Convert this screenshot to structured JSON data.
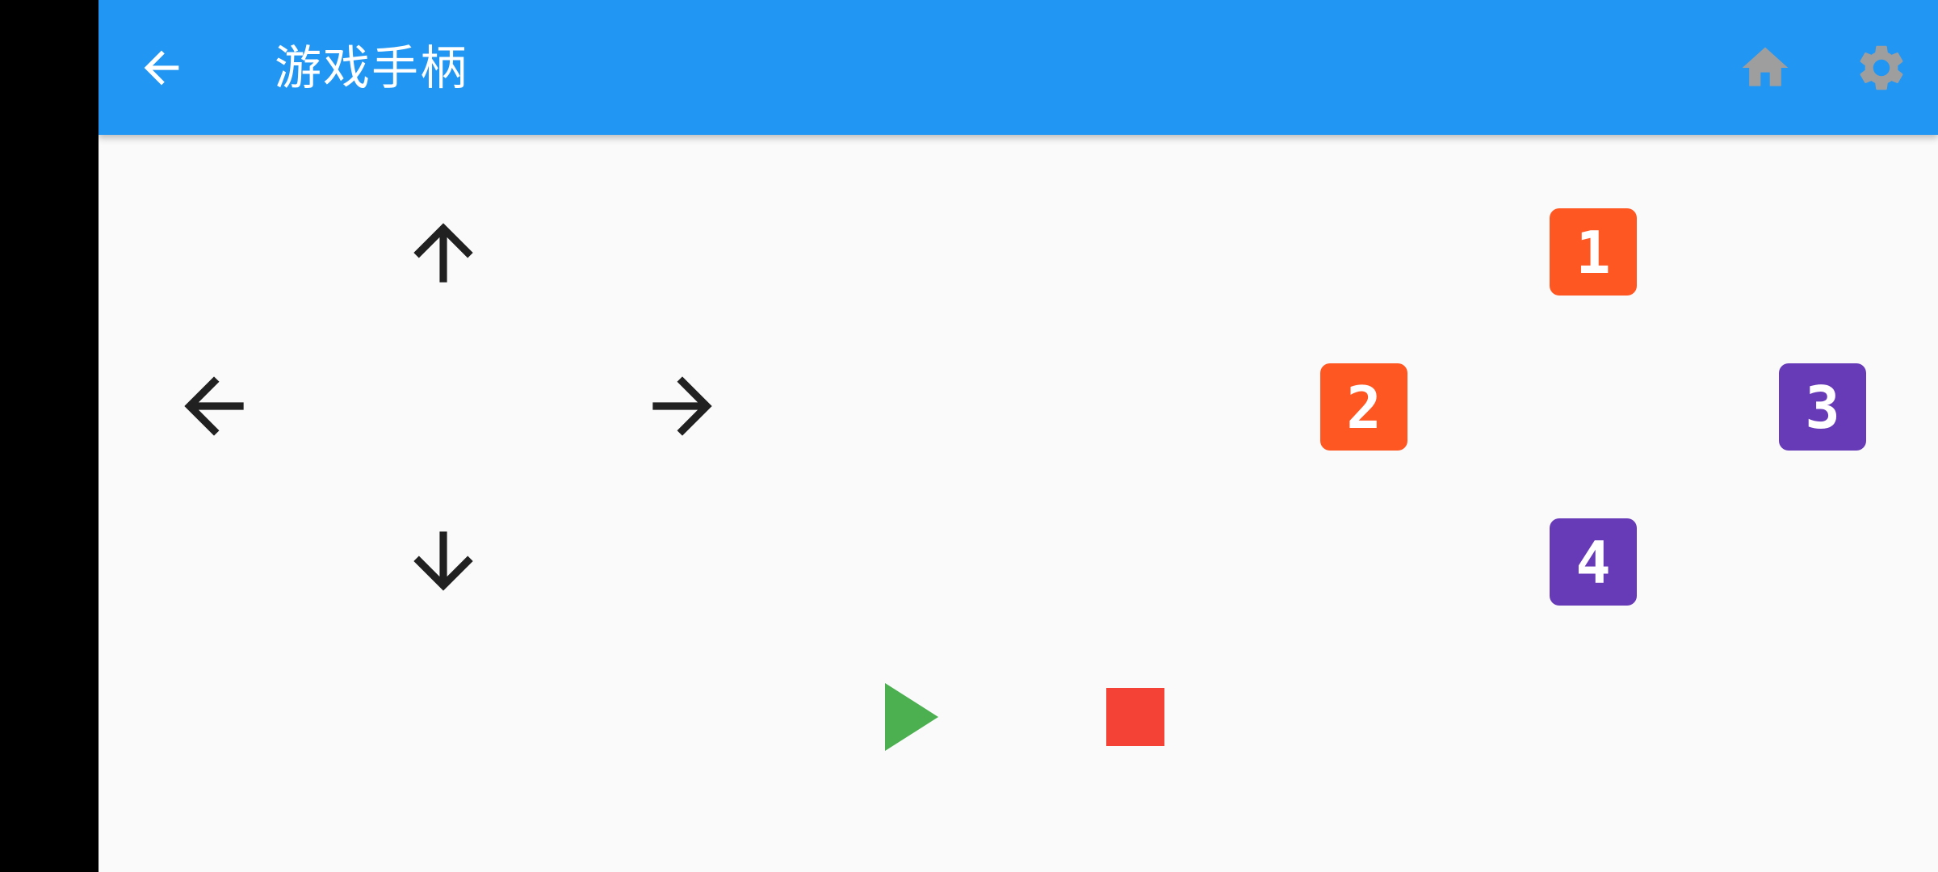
{
  "appbar": {
    "title": "游戏手柄",
    "back_icon": "arrow-back-icon",
    "home_icon": "home-icon",
    "settings_icon": "gear-icon",
    "color": "#2196f3"
  },
  "dpad": {
    "up_icon": "arrow-up-icon",
    "down_icon": "arrow-down-icon",
    "left_icon": "arrow-left-icon",
    "right_icon": "arrow-right-icon"
  },
  "action_buttons": [
    {
      "label": "1",
      "color": "#ff5722"
    },
    {
      "label": "2",
      "color": "#ff5722"
    },
    {
      "label": "3",
      "color": "#673ab7"
    },
    {
      "label": "4",
      "color": "#673ab7"
    }
  ],
  "controls": {
    "play_icon": "play-icon",
    "play_color": "#4caf50",
    "stop_icon": "stop-icon",
    "stop_color": "#f44336"
  }
}
